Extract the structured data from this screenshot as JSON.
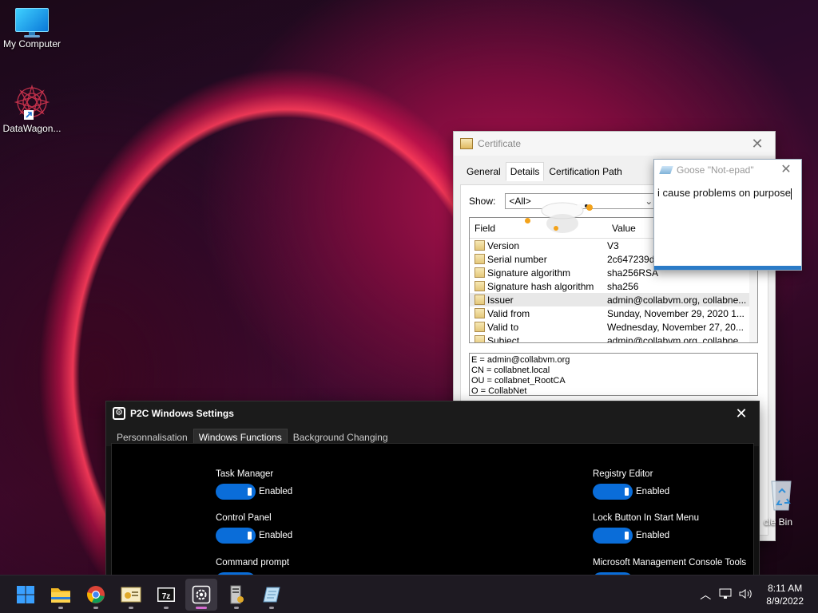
{
  "desktop": {
    "icons": [
      {
        "label": "My Computer"
      },
      {
        "label": "DataWagon..."
      }
    ],
    "recycle_label": "cle Bin"
  },
  "certificate": {
    "title": "Certificate",
    "tabs": [
      "General",
      "Details",
      "Certification Path"
    ],
    "active_tab": "Details",
    "show_label": "Show:",
    "show_value": "<All>",
    "columns": [
      "Field",
      "Value"
    ],
    "rows": [
      {
        "field": "Version",
        "value": "V3"
      },
      {
        "field": "Serial number",
        "value": "2c647239d"
      },
      {
        "field": "Signature algorithm",
        "value": "sha256RSA"
      },
      {
        "field": "Signature hash algorithm",
        "value": "sha256"
      },
      {
        "field": "Issuer",
        "value": "admin@collabvm.org, collabne..."
      },
      {
        "field": "Valid from",
        "value": "Sunday, November 29, 2020 1..."
      },
      {
        "field": "Valid to",
        "value": "Wednesday, November 27, 20..."
      },
      {
        "field": "Subject",
        "value": "admin@collabvm.org, collabne..."
      }
    ],
    "selected_row": "Issuer",
    "details_lines": [
      "E = admin@collabvm.org",
      "CN = collabnet.local",
      "OU = collabnet_RootCA",
      "O = CollabNet"
    ]
  },
  "goose_notepad": {
    "title": "Goose \"Not-epad\"",
    "text": "i cause problems on purpose"
  },
  "p2c": {
    "title": "P2C Windows Settings",
    "tabs": [
      "Personnalisation",
      "Windows Functions",
      "Background Changing"
    ],
    "active_tab": "Windows Functions",
    "left_functions": [
      {
        "label": "Task Manager",
        "state": "Enabled"
      },
      {
        "label": "Control Panel",
        "state": "Enabled"
      },
      {
        "label": "Command prompt",
        "state": ""
      }
    ],
    "right_functions": [
      {
        "label": "Registry Editor",
        "state": "Enabled"
      },
      {
        "label": "Lock Button In Start Menu",
        "state": "Enabled"
      },
      {
        "label": "Microsoft Management Console Tools",
        "state": ""
      }
    ]
  },
  "taskbar": {
    "items": [
      "start-icon",
      "file-explorer-icon",
      "chrome-icon",
      "certificate-manager-icon",
      "7zip-icon",
      "settings-gear-icon",
      "server-tool-icon",
      "notepad-icon"
    ],
    "active_item": "settings-gear-icon",
    "time": "8:11 AM",
    "date": "8/9/2022"
  },
  "colors": {
    "accent": "#0a6dd9",
    "taskbar": "#1e1a22"
  }
}
